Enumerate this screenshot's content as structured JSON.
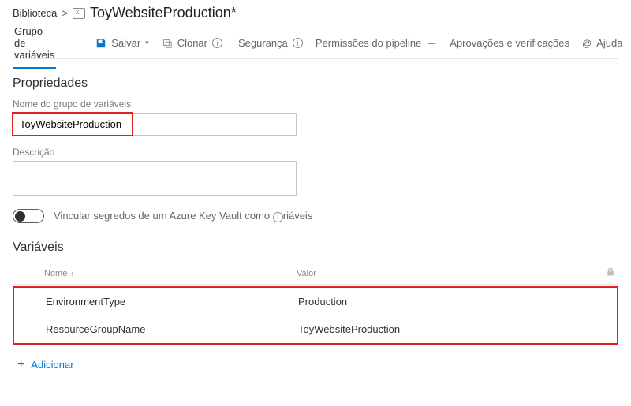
{
  "breadcrumb": {
    "library": "Biblioteca",
    "sep": ">",
    "title": "ToyWebsiteProduction*"
  },
  "tabs": {
    "vars": "Grupo de variáveis"
  },
  "toolbar": {
    "save": "Salvar",
    "clone": "Clonar",
    "security": "Segurança",
    "permissions": "Permissões do pipeline",
    "approvals": "Aprovações e verificações",
    "help": "Ajuda"
  },
  "sections": {
    "properties": "Propriedades",
    "variables": "Variáveis"
  },
  "fields": {
    "name_label": "Nome do grupo de variáveis",
    "name_value": "ToyWebsiteProduction",
    "desc_label": "Descrição",
    "desc_value": ""
  },
  "kv_toggle": {
    "text_a": "Vincular segredos de um Azure Key Vault como",
    "text_b": "riáveis"
  },
  "var_cols": {
    "name": "Nome",
    "value": "Valor"
  },
  "vars": [
    {
      "name": "EnvironmentType",
      "value": "Production"
    },
    {
      "name": "ResourceGroupName",
      "value": "ToyWebsiteProduction"
    }
  ],
  "add": "Adicionar"
}
